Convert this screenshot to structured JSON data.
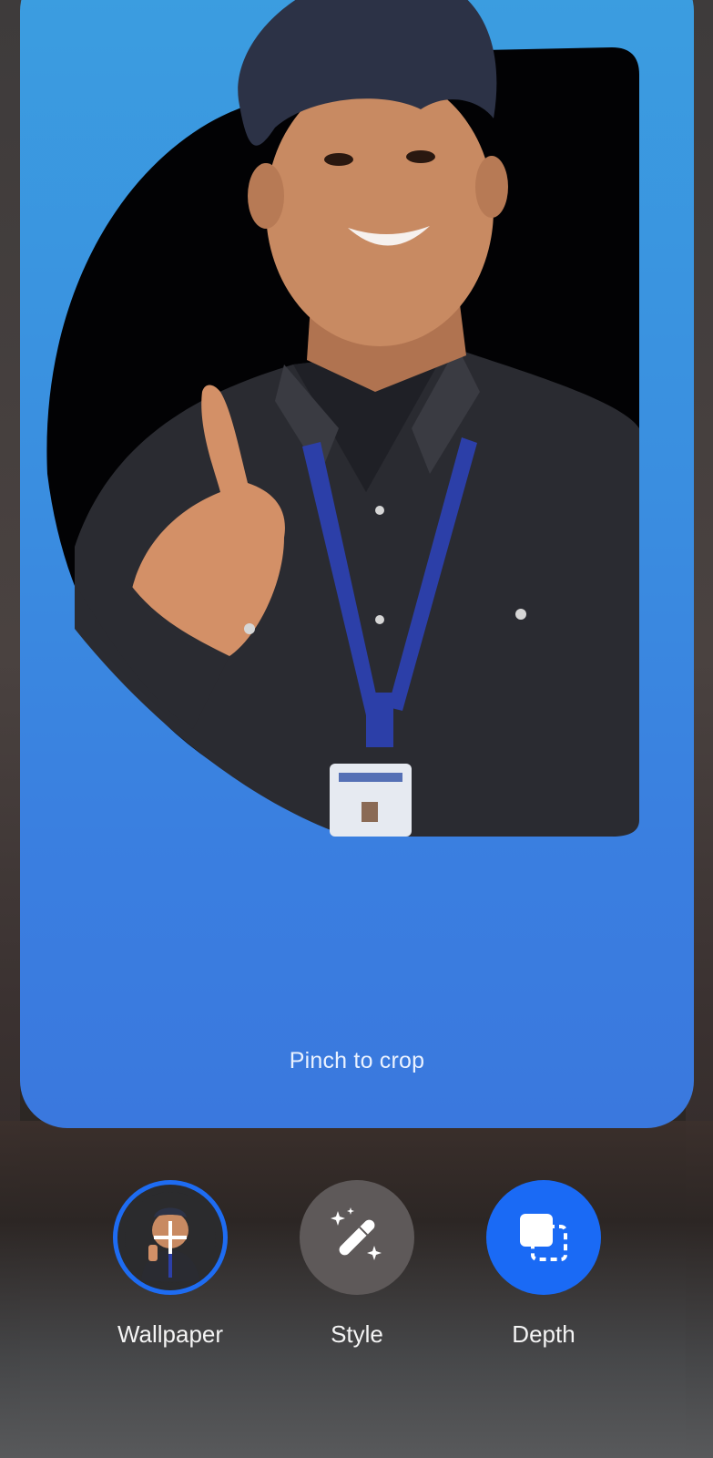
{
  "preview": {
    "crop_hint": "Pinch to crop",
    "photo_icon": "person-thumbs-up-photo"
  },
  "options": {
    "wallpaper": {
      "label": "Wallpaper",
      "icon": "wallpaper-thumbnail-icon",
      "selected": true
    },
    "style": {
      "label": "Style",
      "icon": "magic-wand-icon"
    },
    "depth": {
      "label": "Depth",
      "icon": "depth-layers-icon",
      "active": true
    }
  },
  "colors": {
    "accent": "#1a6af5",
    "card_top": "#3b9ee0",
    "card_bottom": "#3a78de"
  }
}
